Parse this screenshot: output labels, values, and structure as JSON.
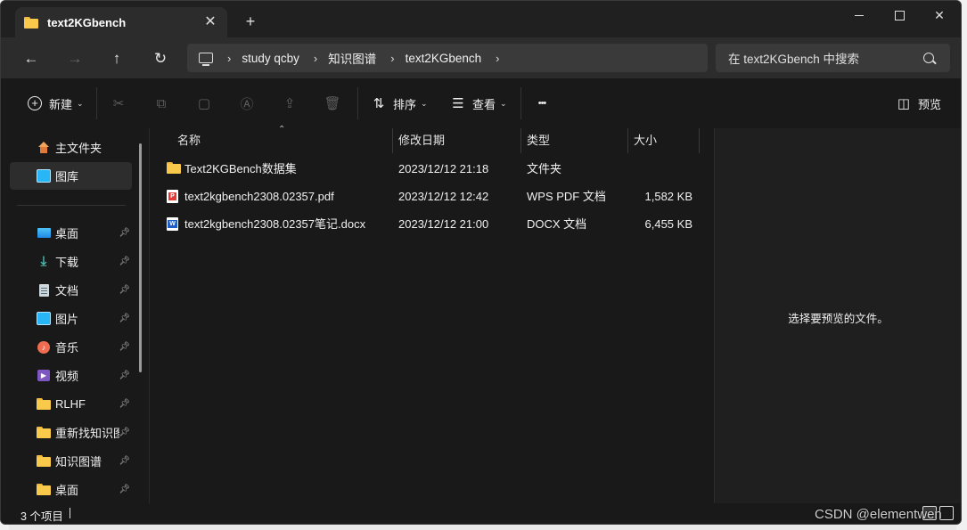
{
  "window": {
    "tab_title": "text2KGbench",
    "tab_close_icon": "close-icon",
    "new_tab_icon": "plus-icon",
    "controls": {
      "minimize": "minimize-icon",
      "maximize": "maximize-icon",
      "close": "close-icon"
    }
  },
  "nav": {
    "back": "←",
    "forward": "→",
    "up": "↑",
    "refresh": "↻",
    "breadcrumbs": [
      "study qcby",
      "知识图谱",
      "text2KGbench"
    ],
    "crumb_sep": "›",
    "search_placeholder": "在 text2KGbench 中搜索"
  },
  "toolbar": {
    "new_label": "新建",
    "sort_label": "排序",
    "view_label": "查看",
    "more_label": "•••",
    "preview_label": "预览"
  },
  "sidebar": {
    "top_items": [
      {
        "label": "主文件夹",
        "icon": "home-icon"
      },
      {
        "label": "图库",
        "icon": "gallery-icon",
        "selected": true
      }
    ],
    "pinned_items": [
      {
        "label": "桌面",
        "icon": "desktop-icon",
        "pinned": true
      },
      {
        "label": "下载",
        "icon": "download-icon",
        "pinned": true
      },
      {
        "label": "文档",
        "icon": "documents-icon",
        "pinned": true
      },
      {
        "label": "图片",
        "icon": "pictures-icon",
        "pinned": true
      },
      {
        "label": "音乐",
        "icon": "music-icon",
        "pinned": true
      },
      {
        "label": "视频",
        "icon": "video-icon",
        "pinned": true
      },
      {
        "label": "RLHF",
        "icon": "folder-icon",
        "pinned": true
      },
      {
        "label": "重新找知识图谱",
        "icon": "folder-icon",
        "pinned": true
      },
      {
        "label": "知识图谱",
        "icon": "folder-icon",
        "pinned": true
      },
      {
        "label": "桌面",
        "icon": "folder-icon",
        "pinned": true
      }
    ]
  },
  "file_list": {
    "columns": [
      "名称",
      "修改日期",
      "类型",
      "大小"
    ],
    "rows": [
      {
        "name": "Text2KGBench数据集",
        "modified": "2023/12/12 21:18",
        "type": "文件夹",
        "size": "",
        "icon": "folder-icon"
      },
      {
        "name": "text2kgbench2308.02357.pdf",
        "modified": "2023/12/12 12:42",
        "type": "WPS PDF 文档",
        "size": "1,582 KB",
        "icon": "pdf-file-icon"
      },
      {
        "name": "text2kgbench2308.02357笔记.docx",
        "modified": "2023/12/12 21:00",
        "type": "DOCX 文档",
        "size": "6,455 KB",
        "icon": "docx-file-icon"
      }
    ]
  },
  "preview": {
    "message": "选择要预览的文件。"
  },
  "status": {
    "item_count": "3 个项目"
  },
  "watermark": "CSDN @elementwen",
  "colors": {
    "window_bg": "#191919",
    "chrome_bg": "#2c2c2c",
    "folder": "#f8c94b",
    "accent": "#4cc2ff"
  }
}
